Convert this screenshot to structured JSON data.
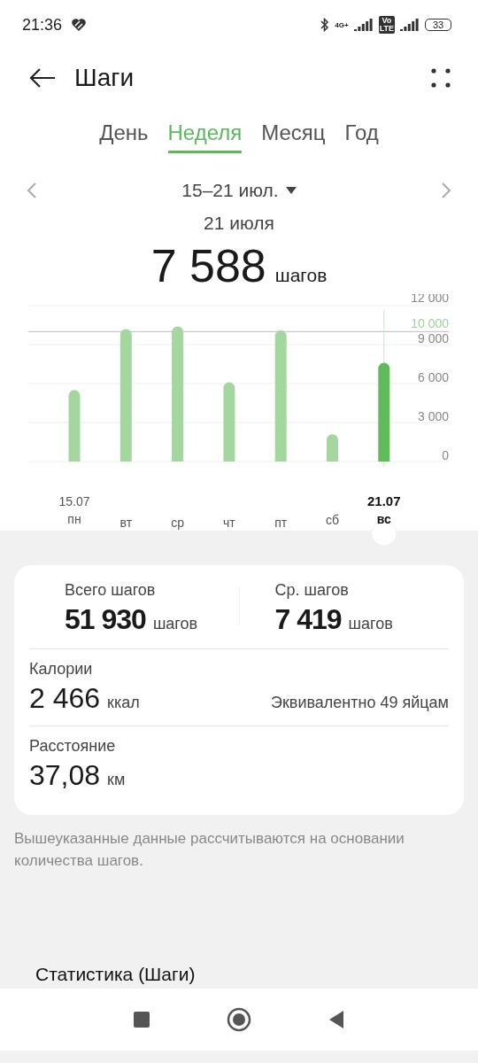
{
  "status_bar": {
    "time": "21:36",
    "network": "4G+",
    "volte_top": "Vo",
    "volte_bottom": "LTE",
    "battery": "33"
  },
  "header": {
    "title": "Шаги"
  },
  "tabs": [
    {
      "label": "День",
      "selected": false
    },
    {
      "label": "Неделя",
      "selected": true
    },
    {
      "label": "Месяц",
      "selected": false
    },
    {
      "label": "Год",
      "selected": false
    }
  ],
  "range": {
    "label": "15–21 июл."
  },
  "selected_day": {
    "date": "21 июля",
    "value": "7 588",
    "unit": "шагов"
  },
  "chart": {
    "chart_data": {
      "type": "bar",
      "categories": [
        "пн",
        "вт",
        "ср",
        "чт",
        "пт",
        "сб",
        "вс"
      ],
      "series": [
        {
          "color": "#a3d79f",
          "values": [
            5500,
            10200,
            10400,
            6100,
            10100,
            2100,
            null
          ]
        },
        {
          "color": "#62bb5a",
          "values": [
            null,
            null,
            null,
            null,
            null,
            null,
            7600
          ]
        }
      ],
      "grid": true,
      "ylim": [
        0,
        12000
      ],
      "yticks": [
        {
          "value": 0,
          "label": "0"
        },
        {
          "value": 3000,
          "label": "3 000"
        },
        {
          "value": 6000,
          "label": "6 000"
        },
        {
          "value": 9000,
          "label": "9 000"
        },
        {
          "value": 12000,
          "label": "12 000"
        }
      ],
      "ref_lines": [
        {
          "axis": "y",
          "value": 10000,
          "label": "10 000"
        }
      ]
    },
    "days": [
      {
        "date": "15.07",
        "selected": false
      },
      {
        "selected": false
      },
      {
        "selected": false
      },
      {
        "selected": false
      },
      {
        "selected": false
      },
      {
        "selected": false
      },
      {
        "date": "21.07",
        "selected": true
      }
    ]
  },
  "summary": {
    "total": {
      "label": "Всего шагов",
      "value": "51 930",
      "unit": "шагов"
    },
    "average": {
      "label": "Ср. шагов",
      "value": "7 419",
      "unit": "шагов"
    },
    "calories": {
      "label": "Калории",
      "value": "2 466",
      "unit": "ккал",
      "note": "Эквивалентно 49 яйцам"
    },
    "distance": {
      "label": "Расстояние",
      "value": "37,08",
      "unit": "км"
    }
  },
  "footnote": "Вышеуказанные данные рассчитываются на основании количества шагов.",
  "statistics": {
    "title": "Статистика (Шаги)"
  }
}
